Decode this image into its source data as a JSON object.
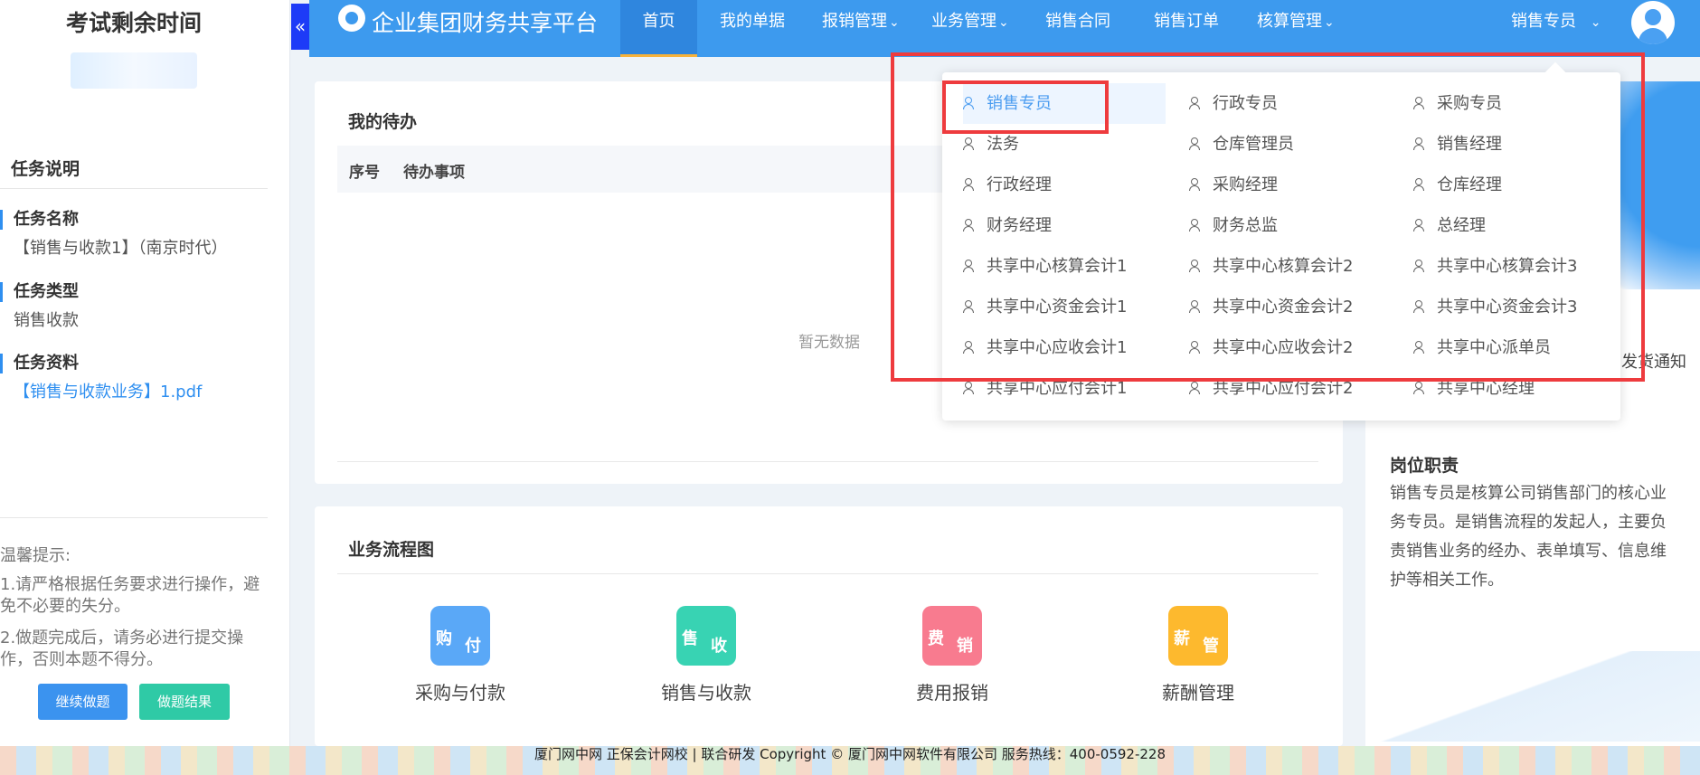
{
  "left_panel": {
    "timer_title": "考试剩余时间",
    "section_title": "任务说明",
    "task_name_label": "任务名称",
    "task_name": "【销售与收款1】（南京时代）",
    "task_type_label": "任务类型",
    "task_type": "销售收款",
    "task_material_label": "任务资料",
    "task_material": "【销售与收款业务】1.pdf",
    "tips_title": "温馨提示:",
    "tip1": "1.请严格根据任务要求进行操作，避免不必要的失分。",
    "tip2": "2.做题完成后，请务必进行提交操作，否则本题不得分。",
    "continue_button": "继续做题",
    "result_button": "做题结果",
    "collapse_icon": "«"
  },
  "navbar": {
    "app_title": "企业集团财务共享平台",
    "items": [
      {
        "label": "首页",
        "active": true
      },
      {
        "label": "我的单据"
      },
      {
        "label": "报销管理",
        "dropdown": true
      },
      {
        "label": "业务管理",
        "dropdown": true
      },
      {
        "label": "销售合同"
      },
      {
        "label": "销售订单"
      },
      {
        "label": "核算管理",
        "dropdown": true
      }
    ],
    "current_role": "销售专员",
    "chevron": "⌄"
  },
  "todo": {
    "title": "我的待办",
    "col_index": "序号",
    "col_item": "待办事项",
    "empty_text": "暂无数据"
  },
  "flow": {
    "title": "业务流程图",
    "items": [
      {
        "label": "采购与付款",
        "glyph_a": "购",
        "glyph_b": "付",
        "color": "#5aa8f7"
      },
      {
        "label": "销售与收款",
        "glyph_a": "售",
        "glyph_b": "收",
        "color": "#38d3b3"
      },
      {
        "label": "费用报销",
        "glyph_a": "费",
        "glyph_b": "销",
        "color": "#f87b8f"
      },
      {
        "label": "薪酬管理",
        "glyph_a": "薪",
        "glyph_b": "管",
        "color": "#fdb92e"
      }
    ]
  },
  "role_info": {
    "notice_tail": "发货通知",
    "duty_title": "岗位职责",
    "duty_text": "销售专员是核算公司销售部门的核心业务专员。是销售流程的发起人，主要负责销售业务的经办、表单填写、信息维护等相关工作。"
  },
  "role_dropdown": {
    "roles": [
      [
        "销售专员",
        "行政专员",
        "采购专员"
      ],
      [
        "法务",
        "仓库管理员",
        "销售经理"
      ],
      [
        "行政经理",
        "采购经理",
        "仓库经理"
      ],
      [
        "财务经理",
        "财务总监",
        "总经理"
      ],
      [
        "共享中心核算会计1",
        "共享中心核算会计2",
        "共享中心核算会计3"
      ],
      [
        "共享中心资金会计1",
        "共享中心资金会计2",
        "共享中心资金会计3"
      ],
      [
        "共享中心应收会计1",
        "共享中心应收会计2",
        "共享中心派单员"
      ],
      [
        "共享中心应付会计1",
        "共享中心应付会计2",
        "共享中心经理"
      ]
    ],
    "selected": "销售专员",
    "highlight_color": "#ee3b3e"
  },
  "footer": {
    "text": "厦门网中网 正保会计网校 | 联合研发 Copyright © 厦门网中网软件有限公司 服务热线：400-0592-228"
  }
}
